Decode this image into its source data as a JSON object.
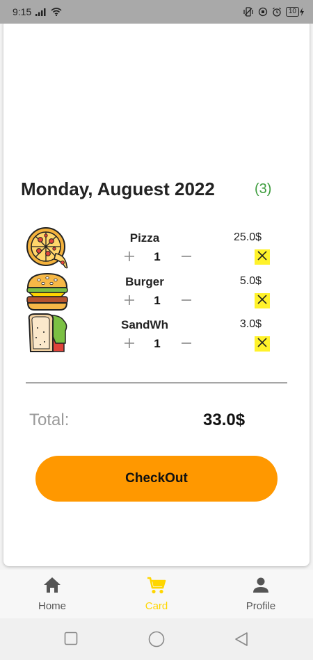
{
  "status_bar": {
    "time": "9:15",
    "battery": "10"
  },
  "cart": {
    "date_title": "Monday, Auguest 2022",
    "item_count": "(3)",
    "items": [
      {
        "name": "Pizza",
        "price": "25.0$",
        "quantity": "1",
        "icon": "pizza-icon"
      },
      {
        "name": "Burger",
        "price": "5.0$",
        "quantity": "1",
        "icon": "burger-icon"
      },
      {
        "name": "SandWh",
        "price": "3.0$",
        "quantity": "1",
        "icon": "sandwich-icon"
      }
    ],
    "total_label": "Total:",
    "total_value": "33.0$",
    "checkout_label": "CheckOut"
  },
  "bottom_nav": {
    "items": [
      {
        "label": "Home",
        "icon": "home-icon",
        "active": false
      },
      {
        "label": "Card",
        "icon": "cart-icon",
        "active": true
      },
      {
        "label": "Profile",
        "icon": "person-icon",
        "active": false
      }
    ]
  },
  "colors": {
    "accent": "#ff9800",
    "active_nav": "#ffd600",
    "count": "#3c9c3c",
    "remove_bg": "#fff22a"
  }
}
